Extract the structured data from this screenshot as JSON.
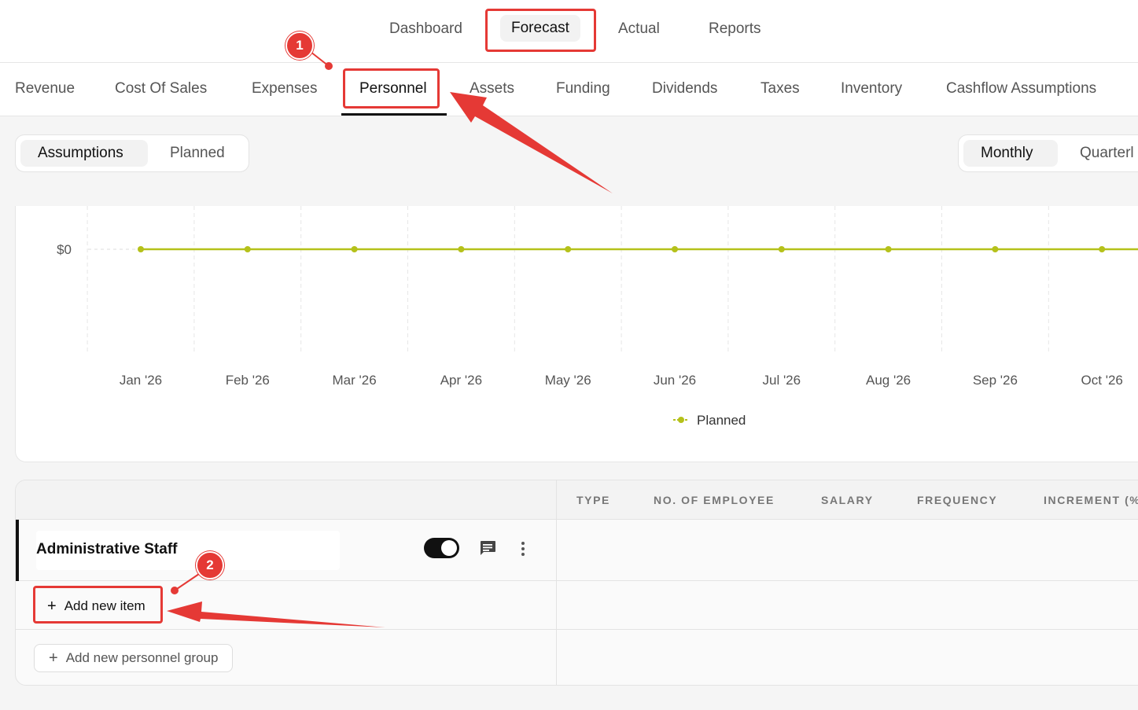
{
  "top_nav": {
    "items": [
      "Dashboard",
      "Forecast",
      "Actual",
      "Reports"
    ],
    "active": "Forecast"
  },
  "sub_nav": {
    "tabs": [
      "Revenue",
      "Cost Of Sales",
      "Expenses",
      "Personnel",
      "Assets",
      "Funding",
      "Dividends",
      "Taxes",
      "Inventory",
      "Cashflow Assumptions"
    ],
    "active": "Personnel"
  },
  "view_toggle": {
    "options": [
      "Assumptions",
      "Planned"
    ],
    "active": "Assumptions"
  },
  "period_toggle": {
    "options": [
      "Monthly",
      "Quarterl"
    ],
    "active": "Monthly"
  },
  "chart_data": {
    "type": "line",
    "categories": [
      "Jan '26",
      "Feb '26",
      "Mar '26",
      "Apr '26",
      "May '26",
      "Jun '26",
      "Jul '26",
      "Aug '26",
      "Sep '26",
      "Oct '26"
    ],
    "series": [
      {
        "name": "Planned",
        "values": [
          0,
          0,
          0,
          0,
          0,
          0,
          0,
          0,
          0,
          0
        ],
        "color": "#b5c11a"
      }
    ],
    "y_tick_labels": [
      "$0"
    ],
    "grid": true,
    "legend": "bottom-center"
  },
  "table": {
    "columns": [
      "TYPE",
      "NO. OF EMPLOYEE",
      "SALARY",
      "FREQUENCY",
      "INCREMENT (%"
    ],
    "group": {
      "name": "Administrative Staff",
      "enabled": true
    },
    "add_item_label": "Add new item",
    "add_group_label": "Add new personnel group"
  },
  "annotations": {
    "badges": [
      "1",
      "2"
    ],
    "color": "#e53935"
  }
}
